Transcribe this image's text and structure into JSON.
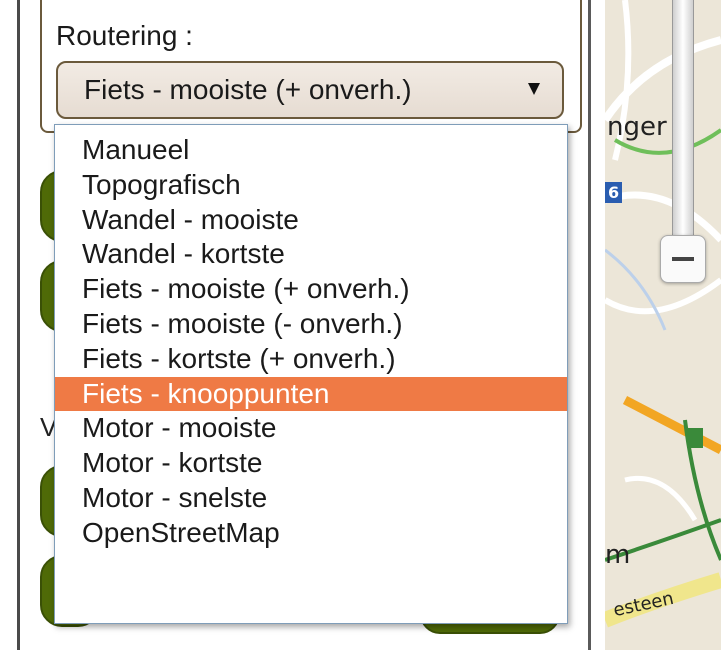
{
  "routing": {
    "label": "Routering :",
    "selected_value": "Fiets - mooiste (+ onverh.)",
    "options": [
      "Manueel",
      "Topografisch",
      "Wandel - mooiste",
      "Wandel - kortste",
      "Fiets - mooiste (+ onverh.)",
      "Fiets - mooiste (- onverh.)",
      "Fiets - kortste (+ onverh.)",
      "Fiets - knooppunten",
      "Motor - mooiste",
      "Motor - kortste",
      "Motor - snelste",
      "OpenStreetMap"
    ],
    "highlighted_option": "Fiets - knooppunten",
    "highlight_color": "#ef7a45"
  },
  "left_panel": {
    "partial_letter": "V",
    "button_color": "#4f6a07"
  },
  "map": {
    "label_top": "nger",
    "route_badge": "6",
    "label_bottom": "m",
    "street_label": "esteen",
    "zoom_out_icon": "minus-icon",
    "road_color": "#f2a623",
    "route_color": "#3a8a3a"
  }
}
